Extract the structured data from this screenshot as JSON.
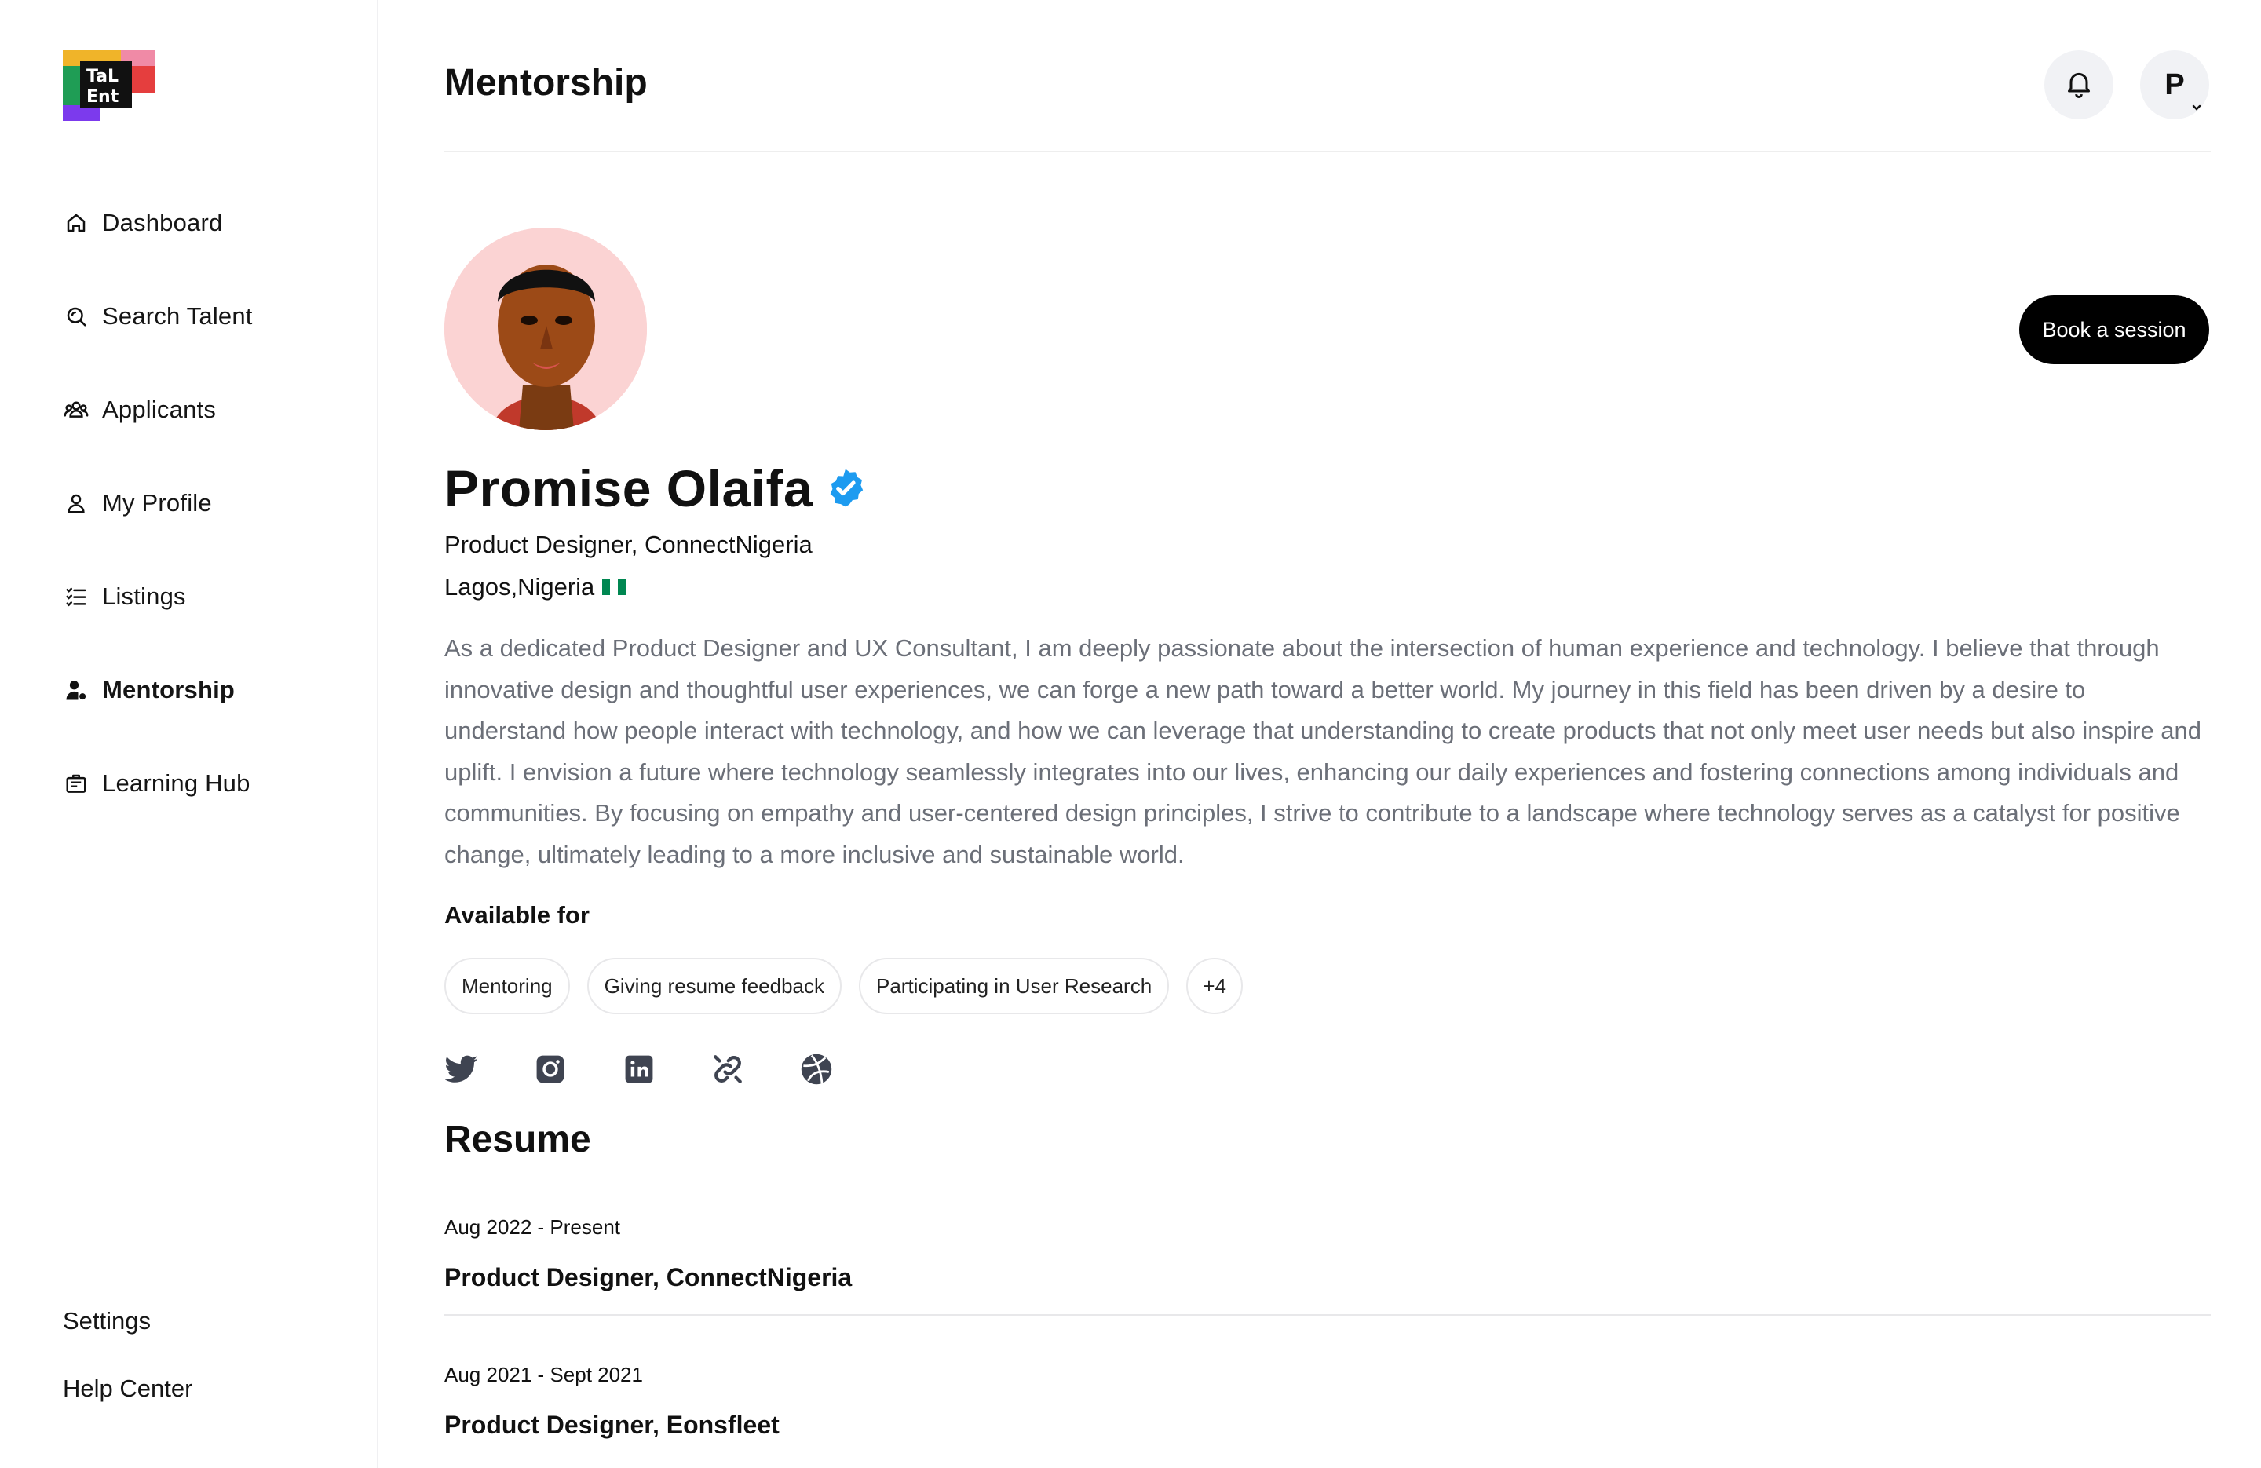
{
  "app": {
    "logo_text": "TaLent"
  },
  "sidebar": {
    "items": [
      {
        "label": "Dashboard",
        "icon": "home-icon"
      },
      {
        "label": "Search Talent",
        "icon": "search-icon"
      },
      {
        "label": "Applicants",
        "icon": "users-icon"
      },
      {
        "label": "My Profile",
        "icon": "user-icon"
      },
      {
        "label": "Listings",
        "icon": "list-icon"
      },
      {
        "label": "Mentorship",
        "icon": "mentor-icon",
        "active": true
      },
      {
        "label": "Learning Hub",
        "icon": "briefcase-icon"
      }
    ],
    "bottom": [
      {
        "label": "Settings"
      },
      {
        "label": "Help Center"
      }
    ]
  },
  "header": {
    "title": "Mentorship",
    "avatar_initial": "P"
  },
  "profile": {
    "name": "Promise Olaifa",
    "verified": true,
    "role": "Product Designer, ConnectNigeria",
    "location": "Lagos,Nigeria",
    "bio": "As a dedicated Product Designer and UX Consultant, I am deeply passionate about the intersection of human experience and technology. I believe that through innovative design and thoughtful user experiences, we can forge a new path toward a better world. My journey in this field has been driven by a desire to understand how people interact with technology, and how we can leverage that understanding to create products that not only meet user needs but also inspire and uplift. I envision a future where technology seamlessly integrates into our lives, enhancing our daily experiences and fostering connections among individuals and communities. By focusing on empathy and user-centered design principles, I strive to contribute to a landscape where technology serves as a catalyst for positive change, ultimately leading to a more inclusive and sustainable world.",
    "book_label": "Book a session",
    "available_title": "Available for",
    "available": [
      "Mentoring",
      "Giving resume feedback",
      "Participating in User Research"
    ],
    "available_more": "+4",
    "socials": [
      "twitter-icon",
      "instagram-icon",
      "linkedin-icon",
      "link-icon",
      "dribbble-icon"
    ]
  },
  "resume": {
    "title": "Resume",
    "items": [
      {
        "date": "Aug 2022 - Present",
        "role": "Product Designer, ConnectNigeria"
      },
      {
        "date": "Aug 2021 - Sept 2021",
        "role": "Product Designer, Eonsfleet"
      }
    ]
  },
  "colors": {
    "accent_verified": "#1d9bf0",
    "muted_text": "#6b6f78",
    "button_bg": "#000000",
    "nigeria_green": "#008751"
  }
}
